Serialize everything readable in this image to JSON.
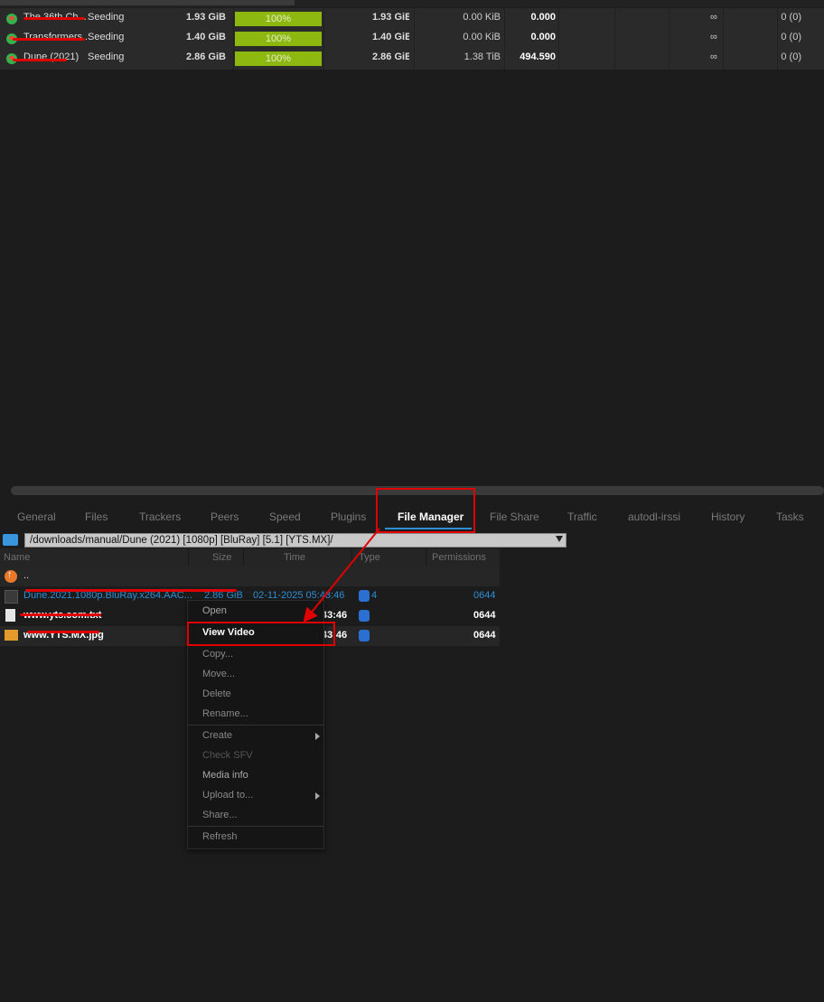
{
  "torrents": [
    {
      "name": "The 36th Ch...",
      "status": "Seeding",
      "size": "1.93 GiB",
      "progress": "100%",
      "done": "1.93 GiB",
      "uploaded": "0.00 KiB",
      "ratio": "0.000",
      "eta": "∞",
      "peers": "0 (0)"
    },
    {
      "name": "Transformers...",
      "status": "Seeding",
      "size": "1.40 GiB",
      "progress": "100%",
      "done": "1.40 GiB",
      "uploaded": "0.00 KiB",
      "ratio": "0.000",
      "eta": "∞",
      "peers": "0 (0)"
    },
    {
      "name": "Dune (2021)",
      "status": "Seeding",
      "size": "2.86 GiB",
      "progress": "100%",
      "done": "2.86 GiB",
      "uploaded": "1.38 TiB",
      "ratio": "494.590",
      "eta": "∞",
      "peers": "0 (0)"
    }
  ],
  "tabs": [
    "General",
    "Files",
    "Trackers",
    "Peers",
    "Speed",
    "Plugins",
    "File Manager",
    "File Share",
    "Traffic",
    "autodl-irssi",
    "History",
    "Tasks"
  ],
  "active_tab": "File Manager",
  "path": "/downloads/manual/Dune (2021) [1080p] [BluRay] [5.1] [YTS.MX]/",
  "file_columns": {
    "name": "Name",
    "size": "Size",
    "time": "Time",
    "type": "Type",
    "permissions": "Permissions"
  },
  "files": [
    {
      "name": "..",
      "size": "",
      "time": "",
      "type": "",
      "perm": ""
    },
    {
      "name": "Dune.2021.1080p.BluRay.x264.AAC...",
      "size": "2.86 GiB",
      "time": "02-11-2025 05:43:46",
      "type": "4",
      "perm": "0644"
    },
    {
      "name": "www.yts.com.txt",
      "size": "",
      "time": "43:46",
      "type": "",
      "perm": "0644"
    },
    {
      "name": "www.YTS.MX.jpg",
      "size": "",
      "time": "43:46",
      "type": "",
      "perm": "0644"
    }
  ],
  "context_menu": {
    "open": "Open",
    "view_video": "View Video",
    "copy": "Copy...",
    "move": "Move...",
    "delete": "Delete",
    "rename": "Rename...",
    "create": "Create",
    "check_sfv": "Check SFV",
    "media_info": "Media info",
    "upload_to": "Upload to...",
    "share": "Share...",
    "refresh": "Refresh"
  },
  "colors": {
    "accent": "#2e8fd6",
    "progress": "#8db80f",
    "annotation": "#e00000"
  }
}
